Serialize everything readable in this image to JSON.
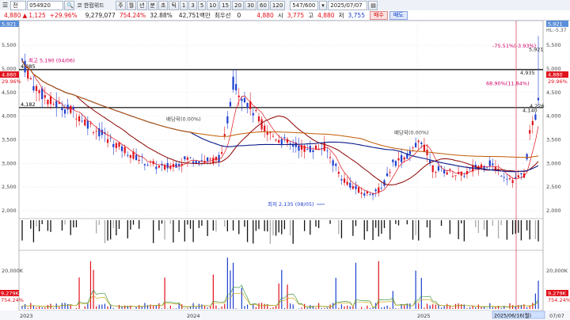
{
  "toolbar": {
    "code": "054920",
    "name": "한컴위드",
    "name_prefix": "코",
    "period_buttons": [
      "주",
      "월",
      "년",
      "분",
      "초",
      "틱",
      "1",
      "3",
      "5",
      "10",
      "15",
      "20",
      "30",
      "60",
      "120"
    ],
    "counter": "547/600",
    "date": "2025/07/07"
  },
  "quote": {
    "price": "4,880",
    "change": "1,125",
    "change_pct": "+29.96%",
    "volume": "9,279,077",
    "vol_ratio": "754.24%",
    "turnover": "32.88%",
    "amount": "42,751백만",
    "preferred_label": "최우선",
    "preferred_val": "0",
    "open_val": "4,880",
    "high_label": "시",
    "high_val": "3,775",
    "low_label": "고",
    "low_val": "4,880",
    "close_label": "저",
    "close_val": "3,755",
    "buy_label": "매수",
    "sell_label": "매도"
  },
  "chart_data": {
    "type": "candlestick",
    "x_labels": [
      "2023",
      "2024",
      "2025",
      "2025/06/16(월)",
      "07/07"
    ],
    "price_axis": [
      "5,500",
      "5,000",
      "4,500",
      "4,000",
      "3,500",
      "3,000",
      "2,500",
      "2,000"
    ],
    "price_axis_top": "5,921",
    "price_axis_sub": "HL:-5.37",
    "price_range": [
      1900,
      5921
    ],
    "left_axis_top": "5,921",
    "left_axis_vals": [
      "5,500",
      "5,000",
      "4,500",
      "4,000",
      "3,500",
      "3,000",
      "2,500",
      "2,000"
    ],
    "left_price_tag": "4,880",
    "left_pct_tag": "29.96%",
    "right_price_tag": "4,880",
    "right_pct_tag": "29.96%",
    "right_top_tag": "5,921",
    "hlines": [
      {
        "value": 4985,
        "label": "4,985"
      },
      {
        "value": 4182,
        "label": "4,182"
      }
    ],
    "annotations": {
      "high": "최고 5,190 (04/06)",
      "low": "최저 2,135 (08/05)",
      "div1": "배당락(0.00%)",
      "div2": "배당락(0.00%)",
      "pct1": "-75.51%(-3.93%)",
      "pct2": "68.90%(11.84%)",
      "right_high": "5,921",
      "mid1": "4,935",
      "mid2": "4,226",
      "mid3": "4,140"
    },
    "volume_axis": [
      "20,000K",
      "9,279K",
      "754.24%"
    ],
    "volume_axis_left": [
      "20,000K",
      "9,279K",
      "754.24%"
    ],
    "series_colors": {
      "up": "#e0101a",
      "down": "#1d3fd0",
      "ma5": "#e0101a",
      "ma20": "#8b0000",
      "ma60": "#0a1a8a",
      "ma120": "#c05a00"
    }
  }
}
